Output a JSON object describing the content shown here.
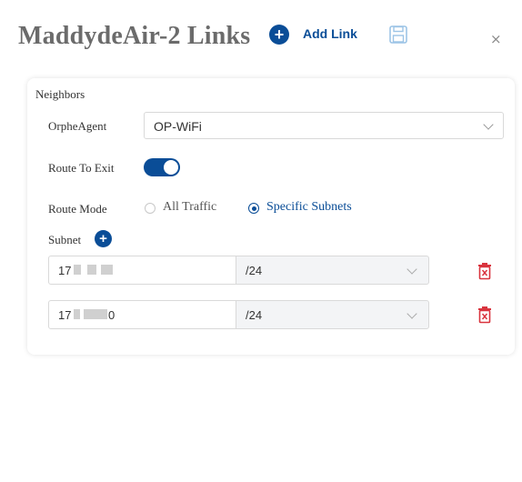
{
  "header": {
    "title": "MaddydeAir-2 Links",
    "add_link_label": "Add Link",
    "add_icon": "plus-circle-icon",
    "save_icon": "save-icon",
    "close_glyph": "×"
  },
  "form": {
    "section_title": "Neighbors",
    "agent": {
      "label": "OrpheAgent",
      "value": "OP-WiFi"
    },
    "route_to_exit": {
      "label": "Route To Exit",
      "enabled": true
    },
    "route_mode": {
      "label": "Route Mode",
      "options": [
        "All Traffic",
        "Specific Subnets"
      ],
      "selected": "Specific Subnets"
    },
    "subnet": {
      "label": "Subnet",
      "rows": [
        {
          "ip": "17",
          "cidr": "/24"
        },
        {
          "ip_prefix": "17",
          "ip_suffix": "0",
          "cidr": "/24"
        }
      ]
    }
  },
  "colors": {
    "accent": "#0a4d97",
    "title": "#6b6b6b",
    "danger": "#d9343e"
  }
}
